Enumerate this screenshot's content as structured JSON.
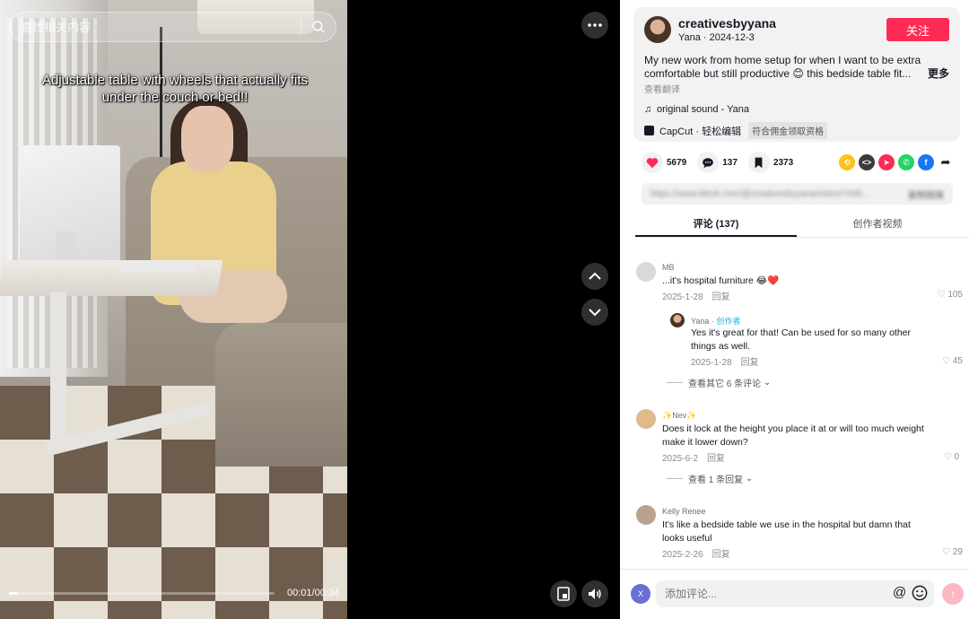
{
  "search": {
    "placeholder": "查找相关内容"
  },
  "video": {
    "caption": "Adjustable table with wheels that actually fits under the couch or bed!!",
    "time": "00:01/00:34",
    "progress_fraction": 0.03
  },
  "author": {
    "handle": "creativesbyyana",
    "sub": "Yana · 2024-12-3",
    "follow_label": "关注"
  },
  "post": {
    "description": "My new work from home setup for when I want to be extra comfortable but still productive 😊 this bedside table fit...",
    "more_label": "更多",
    "translate_label": "查看翻译",
    "music": "original sound - Yana",
    "capcut_label": "CapCut · 轻松编辑",
    "capcut_tag": "符合佣金领取资格"
  },
  "stats": {
    "likes": "5679",
    "comments": "137",
    "saves": "2373"
  },
  "share_icons": [
    "repost-icon",
    "embed-icon",
    "send-icon",
    "whatsapp-icon",
    "facebook-icon",
    "share-arrow-icon"
  ],
  "link": {
    "url": "https://www.tiktok.com/@creativesbyyana/video/7445...",
    "copy_label": "复制链接"
  },
  "tabs": [
    {
      "label": "评论 (137)"
    },
    {
      "label": "创作者视频"
    }
  ],
  "comments": [
    {
      "name": "MB",
      "text": "...it's hospital furniture 😂❤️",
      "date": "2025-1-28",
      "reply": "回复",
      "likes": "105"
    },
    {
      "name": "Yana",
      "creator": "创作者",
      "text": "Yes it's great for that! Can be used for so many other things as well.",
      "date": "2025-1-28",
      "reply": "回复",
      "likes": "45"
    },
    {
      "view_more": "查看其它 6 条评论"
    },
    {
      "name": "✨Nev✨",
      "text": "Does it lock at the height you place it at or will too much weight make it lower down?",
      "date": "2025-6-2",
      "reply": "回复",
      "likes": "0"
    },
    {
      "view_more": "查看 1 条回复"
    },
    {
      "name": "Kelly Renee",
      "text": "It's like a bedside table we use in the hospital but damn that looks useful",
      "date": "2025-2-26",
      "reply": "回复",
      "likes": "29"
    }
  ],
  "comment_input": {
    "placeholder": "添加评论...",
    "me_initial": "X"
  },
  "colors": {
    "accent": "#fe2c55",
    "creator": "#25b0e6",
    "panel_bg": "#ffffff",
    "card_bg": "#f2f2f3"
  }
}
